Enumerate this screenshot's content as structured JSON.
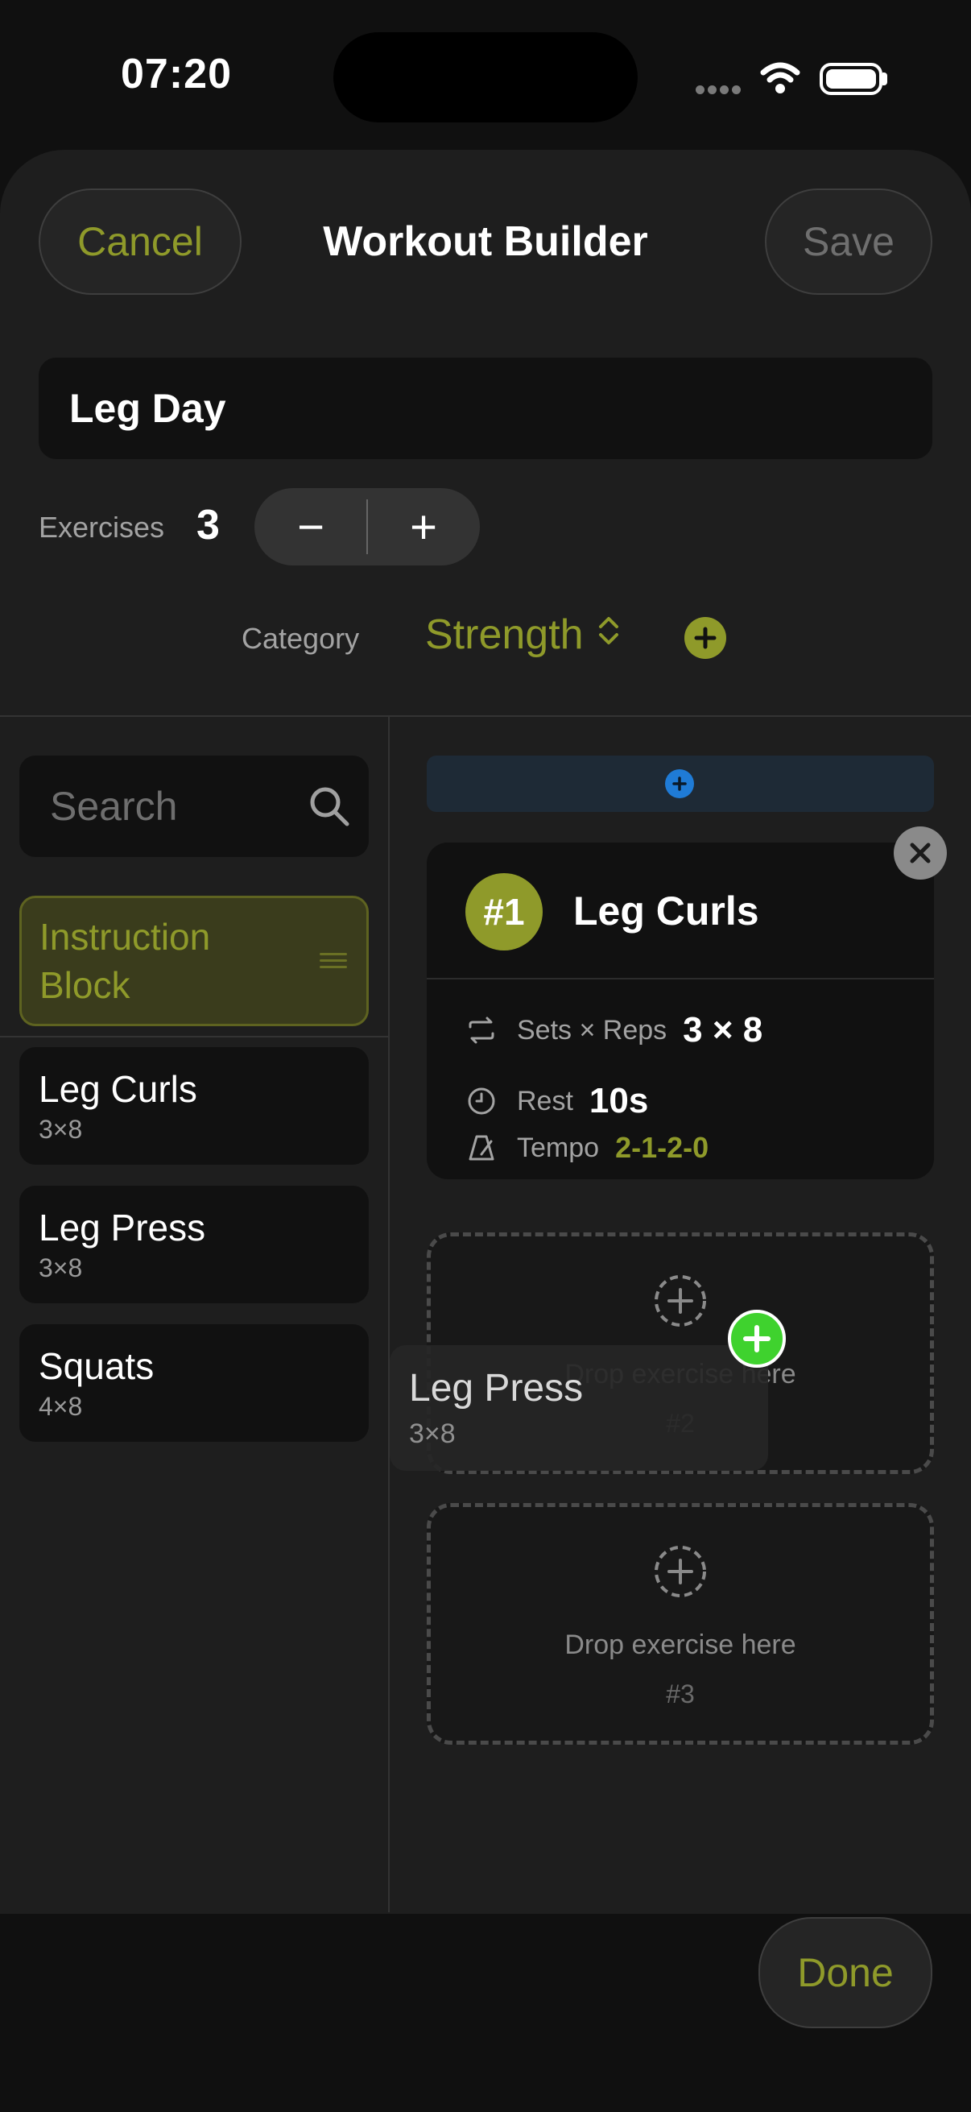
{
  "status_bar": {
    "time": "07:20"
  },
  "header": {
    "cancel_label": "Cancel",
    "title": "Workout Builder",
    "save_label": "Save"
  },
  "workout": {
    "name": "Leg Day",
    "exercises_label": "Exercises",
    "exercises_count": "3",
    "stepper_minus": "−",
    "stepper_plus": "+",
    "category_label": "Category",
    "category_value": "Strength"
  },
  "library": {
    "search_placeholder": "Search",
    "instruction_block": "Instruction Block",
    "items": [
      {
        "name": "Leg Curls",
        "scheme": "3×8"
      },
      {
        "name": "Leg Press",
        "scheme": "3×8"
      },
      {
        "name": "Squats",
        "scheme": "4×8"
      }
    ]
  },
  "plan": {
    "card": {
      "badge": "#1",
      "name": "Leg Curls",
      "sets_label": "Sets × Reps",
      "sets_value": "3 × 8",
      "rest_label": "Rest",
      "rest_value": "10s",
      "tempo_label": "Tempo",
      "tempo_value": "2-1-2-0"
    },
    "drop_zones": [
      {
        "text": "Drop exercise here",
        "number": "#2"
      },
      {
        "text": "Drop exercise here",
        "number": "#3"
      }
    ]
  },
  "drag_ghost": {
    "name": "Leg Press",
    "scheme": "3×8"
  },
  "footer": {
    "done_label": "Done"
  },
  "colors": {
    "accent": "#8f9a2a",
    "drop_green": "#3fd22e",
    "drop_blue": "#1f7bd6"
  }
}
